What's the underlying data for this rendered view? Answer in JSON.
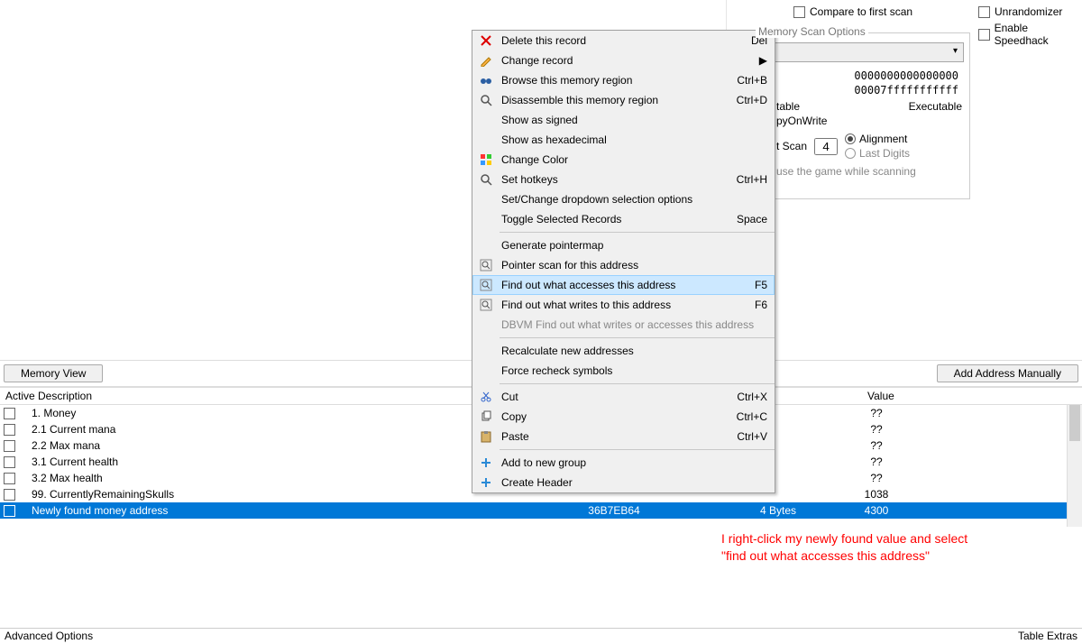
{
  "right_options": {
    "compare_label": "Compare to first scan",
    "unrandomizer_label": "Unrandomizer",
    "speedhack_label": "Enable Speedhack",
    "scan_options_title": "Memory Scan Options",
    "addr_start": "0000000000000000",
    "addr_end": "00007fffffffffff",
    "writable_label": "table",
    "executable_label": "Executable",
    "copyonwrite_label": "pyOnWrite",
    "scan_label": "t Scan",
    "scan_value": "4",
    "alignment_label": "Alignment",
    "lastdigits_label": "Last Digits",
    "pause_label": "use the game while scanning"
  },
  "buttons": {
    "memory_view": "Memory View",
    "add_manually": "Add Address Manually"
  },
  "columns": {
    "active": "Active",
    "description": "Description",
    "address": "",
    "type": "",
    "value": "Value"
  },
  "rows": [
    {
      "desc": "1. Money",
      "addr": "",
      "type": "",
      "value": "??"
    },
    {
      "desc": "2.1 Current mana",
      "addr": "",
      "type": "",
      "value": "??"
    },
    {
      "desc": "2.2 Max mana",
      "addr": "",
      "type": "",
      "value": "??"
    },
    {
      "desc": "3.1 Current health",
      "addr": "",
      "type": "",
      "value": "??"
    },
    {
      "desc": "3.2 Max health",
      "addr": "",
      "type": "",
      "value": "??"
    },
    {
      "desc": "99. CurrentlyRemainingSkulls",
      "addr": "",
      "type": "",
      "value": "1038"
    },
    {
      "desc": "Newly found money address",
      "addr": "36B7EB64",
      "type": "4 Bytes",
      "value": "4300",
      "selected": true
    }
  ],
  "menu": [
    {
      "icon": "x",
      "label": "Delete this record",
      "shortcut": "Del"
    },
    {
      "icon": "pencil",
      "label": "Change record",
      "sub": true
    },
    {
      "icon": "binoc",
      "label": "Browse this memory region",
      "shortcut": "Ctrl+B"
    },
    {
      "icon": "mag",
      "label": "Disassemble this memory region",
      "shortcut": "Ctrl+D"
    },
    {
      "label": "Show as signed"
    },
    {
      "label": "Show as hexadecimal"
    },
    {
      "icon": "color",
      "label": "Change Color"
    },
    {
      "icon": "mag",
      "label": "Set hotkeys",
      "shortcut": "Ctrl+H"
    },
    {
      "label": "Set/Change dropdown selection options"
    },
    {
      "label": "Toggle Selected Records",
      "shortcut": "Space"
    },
    {
      "sep": true
    },
    {
      "label": "Generate pointermap"
    },
    {
      "icon": "magframe",
      "label": "Pointer scan for this address"
    },
    {
      "icon": "magframe",
      "label": "Find out what accesses this address",
      "shortcut": "F5",
      "hl": true
    },
    {
      "icon": "magframe",
      "label": "Find out what writes to this address",
      "shortcut": "F6"
    },
    {
      "label": "DBVM Find out what writes or accesses this address",
      "disabled": true
    },
    {
      "sep": true
    },
    {
      "label": "Recalculate new addresses"
    },
    {
      "label": "Force recheck symbols"
    },
    {
      "sep": true
    },
    {
      "icon": "cut",
      "label": "Cut",
      "shortcut": "Ctrl+X"
    },
    {
      "icon": "copy",
      "label": "Copy",
      "shortcut": "Ctrl+C"
    },
    {
      "icon": "paste",
      "label": "Paste",
      "shortcut": "Ctrl+V"
    },
    {
      "sep": true
    },
    {
      "icon": "plus",
      "label": "Add to new group"
    },
    {
      "icon": "plus",
      "label": "Create Header"
    }
  ],
  "annotation": {
    "line1": "I right-click my newly found value and select",
    "line2": "\"find out what accesses this address\""
  },
  "footer": {
    "left": "Advanced Options",
    "right": "Table Extras"
  }
}
